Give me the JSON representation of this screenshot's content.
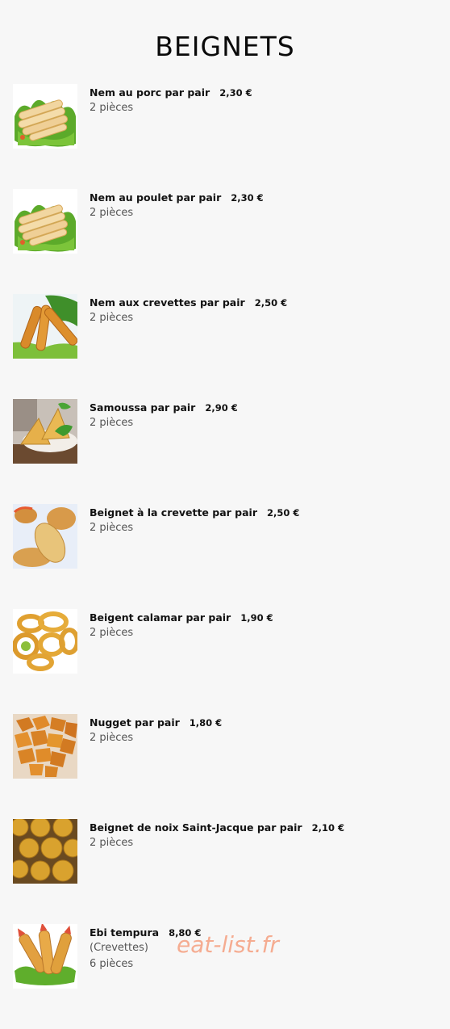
{
  "page": {
    "title": "BEIGNETS"
  },
  "items": [
    {
      "name": "Nem au porc par pair",
      "price": "2,30 €",
      "desc": "",
      "qty": "2 pièces",
      "image": "spring-rolls-lettuce"
    },
    {
      "name": "Nem au poulet par pair",
      "price": "2,30 €",
      "desc": "",
      "qty": "2 pièces",
      "image": "spring-rolls-lettuce"
    },
    {
      "name": "Nem aux crevettes par pair",
      "price": "2,50 €",
      "desc": "",
      "qty": "2 pièces",
      "image": "fried-spring-rolls"
    },
    {
      "name": "Samoussa par pair",
      "price": "2,90 €",
      "desc": "",
      "qty": "2 pièces",
      "image": "samosa-plate"
    },
    {
      "name": "Beignet à la crevette par pair",
      "price": "2,50 €",
      "desc": "",
      "qty": "2 pièces",
      "image": "shrimp-fritters"
    },
    {
      "name": "Beigent calamar par pair",
      "price": "1,90 €",
      "desc": "",
      "qty": "2 pièces",
      "image": "calamari-rings"
    },
    {
      "name": "Nugget par pair",
      "price": "1,80 €",
      "desc": "",
      "qty": "2 pièces",
      "image": "chicken-nuggets"
    },
    {
      "name": "Beignet de noix Saint-Jacque par pair",
      "price": "2,10 €",
      "desc": "",
      "qty": "2 pièces",
      "image": "scallop-fritters"
    },
    {
      "name": "Ebi tempura",
      "price": "8,80 €",
      "desc": "(Crevettes)",
      "qty": "6 pièces",
      "image": "shrimp-tempura"
    }
  ],
  "watermark": "eat-list.fr"
}
